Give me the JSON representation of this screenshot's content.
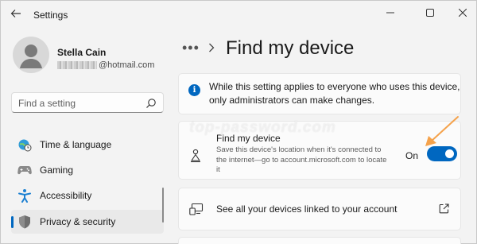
{
  "app": {
    "title": "Settings"
  },
  "user": {
    "name": "Stella Cain",
    "email_suffix": "@hotmail.com"
  },
  "search": {
    "placeholder": "Find a setting",
    "value": ""
  },
  "nav": {
    "items": [
      {
        "label": "Time & language",
        "icon": "clock-globe-icon"
      },
      {
        "label": "Gaming",
        "icon": "gamepad-icon"
      },
      {
        "label": "Accessibility",
        "icon": "accessibility-icon"
      },
      {
        "label": "Privacy & security",
        "icon": "shield-icon",
        "active": true
      }
    ]
  },
  "header": {
    "breadcrumb_more": "•••",
    "title": "Find my device"
  },
  "info_banner": {
    "line1": "While this setting applies to everyone who uses this device,",
    "line2": "only administrators can make changes."
  },
  "find_device": {
    "title": "Find my device",
    "desc_line1": "Save this device's location when it's connected to",
    "desc_line2": "the internet—go to account.microsoft.com to locate",
    "desc_line3": "it",
    "state_label": "On",
    "enabled": true
  },
  "devices_link": {
    "label": "See all your devices linked to your account"
  },
  "watermark": "top-password.com",
  "colors": {
    "accent": "#0067c0",
    "annotation": "#f5a24b",
    "background": "#f3f3f3"
  }
}
